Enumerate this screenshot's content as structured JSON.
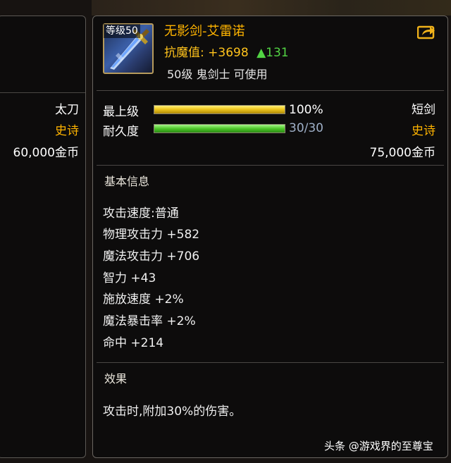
{
  "left_panel": {
    "weapon_type": "太刀",
    "rarity": "史诗",
    "price": "60,000金币"
  },
  "item": {
    "level_tag": "等级50",
    "name": "无影剑-艾雷诺",
    "resist_label": "抗魔值:",
    "resist_value": "+3698",
    "resist_delta": "▲131",
    "requirement": "50级 鬼剑士 可使用"
  },
  "bars": {
    "grade": {
      "label": "最上级",
      "value_text": "100%",
      "fill": 1.0
    },
    "durability": {
      "label": "耐久度",
      "value_text": "30/30",
      "fill": 1.0
    }
  },
  "right_info": {
    "weapon_type": "短剑",
    "rarity": "史诗",
    "price": "75,000金币"
  },
  "basic_info": {
    "title": "基本信息",
    "stats": [
      "攻击速度:普通",
      "物理攻击力 +582",
      "魔法攻击力 +706",
      "智力 +43",
      "施放速度 +2%",
      "魔法暴击率 +2%",
      "命中 +214"
    ]
  },
  "effect": {
    "title": "效果",
    "text": "攻击时,附加30%的伤害。"
  },
  "watermark": "头条 @游戏界的至尊宝",
  "colors": {
    "item_name": "#ffb400",
    "rarity_epic": "#ffb400",
    "resist": "#ffc31c",
    "increase": "#52d444",
    "durability_text": "#9fb0c8"
  },
  "icons": {
    "item": "sword-icon",
    "share": "share-arrow-icon"
  }
}
